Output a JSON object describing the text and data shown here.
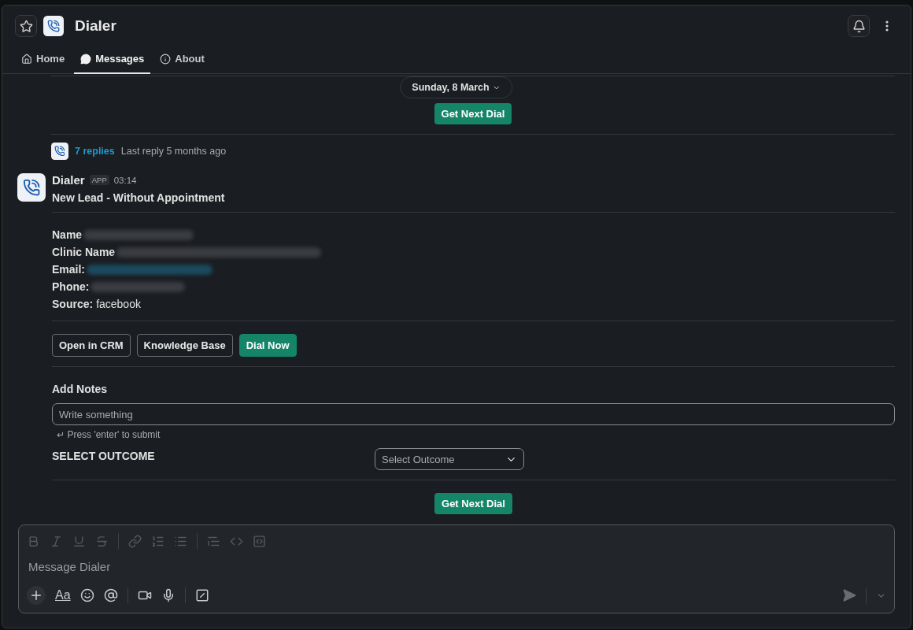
{
  "header": {
    "title": "Dialer",
    "tabs": [
      {
        "label": "Home",
        "kind": "home",
        "selected": false
      },
      {
        "label": "Messages",
        "kind": "message",
        "selected": true
      },
      {
        "label": "About",
        "kind": "info",
        "selected": false
      }
    ]
  },
  "date_divider": {
    "label": "Sunday, 8 March"
  },
  "previous_message": {
    "button": "Get Next Dial"
  },
  "thread": {
    "replies": "7 replies",
    "last_reply": "Last reply 5 months ago"
  },
  "message": {
    "sender": "Dialer",
    "badge": "APP",
    "time": "03:14",
    "heading": "New Lead - Without Appointment",
    "fields": [
      {
        "label": "Name",
        "kind": "text",
        "redacted": true
      },
      {
        "label": "Clinic Name",
        "kind": "text",
        "redacted": true
      },
      {
        "label": "Email:",
        "kind": "link",
        "redacted": true
      },
      {
        "label": "Phone:",
        "kind": "text",
        "redacted": true
      },
      {
        "label": "Source:",
        "kind": "text",
        "redacted": false,
        "value": "facebook"
      }
    ],
    "buttons": [
      {
        "label": "Open in CRM",
        "kind": "outline"
      },
      {
        "label": "Knowledge Base",
        "kind": "outline"
      },
      {
        "label": "Dial Now",
        "kind": "primary"
      }
    ],
    "notes": {
      "title": "Add Notes",
      "placeholder": "Write something",
      "hint": "↵ Press 'enter' to submit"
    },
    "outcome": {
      "label": "SELECT OUTCOME",
      "placeholder": "Select Outcome"
    },
    "next_button": "Get Next Dial"
  },
  "composer": {
    "placeholder": "Message Dialer",
    "format_label": "Aa"
  }
}
